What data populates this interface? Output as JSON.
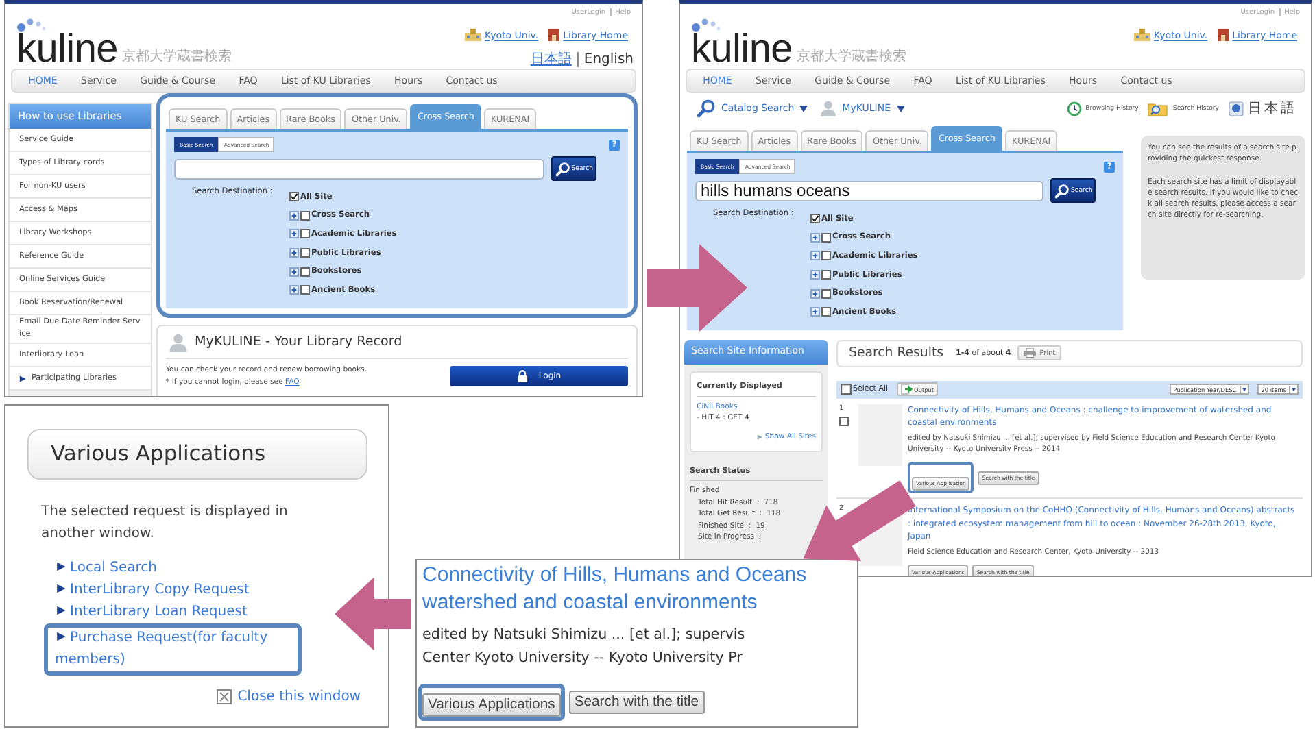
{
  "home_page": {
    "top_links": [
      "UserLogin",
      "Help"
    ],
    "logo": {
      "wordmark": "kuline",
      "subtitle": "京都大学蔵書検索"
    },
    "header_links": [
      {
        "label": "Kyoto Univ.",
        "kind": "university"
      },
      {
        "label": "Library Home",
        "kind": "library"
      }
    ],
    "languages": [
      {
        "label": "日本語",
        "selected": false
      },
      {
        "label": "English",
        "selected": true
      }
    ],
    "nav": [
      {
        "label": "HOME",
        "selected": true
      },
      {
        "label": "Service",
        "selected": false
      },
      {
        "label": "Guide & Course",
        "selected": false
      },
      {
        "label": "FAQ",
        "selected": false
      },
      {
        "label": "List of KU Libraries",
        "selected": false
      },
      {
        "label": "Hours",
        "selected": false
      },
      {
        "label": "Contact us",
        "selected": false
      }
    ],
    "sidebar": {
      "title": "How to use Libraries",
      "items": [
        {
          "label": "Service Guide",
          "kind": "page"
        },
        {
          "label": "Types of Library cards",
          "kind": "page"
        },
        {
          "label": "For non-KU users",
          "kind": "page"
        },
        {
          "label": "Access & Maps",
          "kind": "page"
        },
        {
          "label": "Library Workshops",
          "kind": "page"
        },
        {
          "label": "Reference Guide",
          "kind": "page"
        },
        {
          "label": "Online Services Guide",
          "kind": "page"
        },
        {
          "label": "Book Reservation/Renewal",
          "kind": "page"
        },
        {
          "label": "Email Due Date Reminder Service",
          "kind": "page"
        },
        {
          "label": "Interlibrary Loan",
          "kind": "page"
        },
        {
          "label": "Participating Libraries",
          "kind": "expander"
        }
      ]
    },
    "search": {
      "highlighted": true,
      "tabs": [
        {
          "label": "KU Search",
          "selected": false
        },
        {
          "label": "Articles",
          "selected": false
        },
        {
          "label": "Rare Books",
          "selected": false
        },
        {
          "label": "Other Univ.",
          "selected": false
        },
        {
          "label": "Cross Search",
          "selected": true
        },
        {
          "label": "KURENAI",
          "selected": false
        }
      ],
      "modes": [
        {
          "label": "Basic Search",
          "selected": true
        },
        {
          "label": "Advanced Search",
          "selected": false
        }
      ],
      "help": "?",
      "button": "Search",
      "destination_label": "Search Destination :",
      "destinations": [
        {
          "label": "All Site",
          "checked": true,
          "expandable": false
        },
        {
          "label": "Cross Search",
          "checked": false,
          "expandable": true
        },
        {
          "label": "Academic Libraries",
          "checked": false,
          "expandable": true
        },
        {
          "label": "Public Libraries",
          "checked": false,
          "expandable": true
        },
        {
          "label": "Bookstores",
          "checked": false,
          "expandable": true
        },
        {
          "label": "Ancient Books",
          "checked": false,
          "expandable": true
        }
      ]
    },
    "mykuline": {
      "title": "MyKULINE - Your Library Record",
      "text": "You can check your record and renew borrowing books.",
      "note": "* If you cannot login, please see",
      "link": "FAQ",
      "button": "Login"
    }
  },
  "results_page": {
    "top_links": [
      "UserLogin",
      "Help"
    ],
    "logo": {
      "wordmark": "kuline",
      "subtitle": "京都大学蔵書検索"
    },
    "header_links": [
      {
        "label": "Kyoto Univ.",
        "kind": "university"
      },
      {
        "label": "Library Home",
        "kind": "library"
      }
    ],
    "nav": [
      {
        "label": "HOME",
        "selected": true
      },
      {
        "label": "Service",
        "selected": false
      },
      {
        "label": "Guide & Course",
        "selected": false
      },
      {
        "label": "FAQ",
        "selected": false
      },
      {
        "label": "List of KU Libraries",
        "selected": false
      },
      {
        "label": "Hours",
        "selected": false
      },
      {
        "label": "Contact us",
        "selected": false
      }
    ],
    "menus": [
      {
        "label": "Catalog Search",
        "kind": "search"
      },
      {
        "label": "MyKULINE",
        "kind": "account"
      }
    ],
    "history_links": [
      {
        "label": "Browsing History",
        "kind": "browsing"
      },
      {
        "label": "Search History",
        "kind": "search"
      }
    ],
    "language": "日本語",
    "search": {
      "highlighted": false,
      "tabs": [
        {
          "label": "KU Search",
          "selected": false
        },
        {
          "label": "Articles",
          "selected": false
        },
        {
          "label": "Rare Books",
          "selected": false
        },
        {
          "label": "Other Univ.",
          "selected": false
        },
        {
          "label": "Cross Search",
          "selected": true
        },
        {
          "label": "KURENAI",
          "selected": false
        }
      ],
      "modes": [
        {
          "label": "Basic Search",
          "selected": true
        },
        {
          "label": "Advanced Search",
          "selected": false
        }
      ],
      "help": "?",
      "query": "hills humans oceans",
      "button": "Search",
      "destination_label": "Search Destination :",
      "destinations": [
        {
          "label": "All Site",
          "checked": true,
          "expandable": false
        },
        {
          "label": "Cross Search",
          "checked": false,
          "expandable": true
        },
        {
          "label": "Academic Libraries",
          "checked": false,
          "expandable": true
        },
        {
          "label": "Public Libraries",
          "checked": false,
          "expandable": true
        },
        {
          "label": "Bookstores",
          "checked": false,
          "expandable": true
        },
        {
          "label": "Ancient Books",
          "checked": false,
          "expandable": true
        }
      ]
    },
    "info_note": [
      "You can see the results of a search site providing the quickest response.",
      "Each search site has a limit of displayable search results. If you would like to check all search results, please access a search site directly for re-searching."
    ],
    "site_info": {
      "title": "Search Site Information",
      "displayed_heading": "Currently Displayed",
      "site": "CiNii Books",
      "hits": "- HIT 4 : GET 4",
      "show_all": "Show All Sites",
      "status_heading": "Search Status",
      "status": "Finished",
      "stats": [
        "Total Hit Result  :  718",
        "Total Get Result  :  118",
        "Finished Site  :  19",
        "Site in Progress  :"
      ]
    },
    "results": {
      "title": "Search Results",
      "range": "**1-4** of about **4**",
      "print": "Print",
      "select_all": {
        "label": "Select All",
        "checked": false
      },
      "output": "Output",
      "sort": "Publication Year/DESC",
      "per_page": "20 items",
      "items": [
        {
          "number": "1",
          "checked": false,
          "title": "Connectivity of Hills, Humans and Oceans : challenge to improvement of watershed and coastal environments",
          "authors": "edited by Natsuki Shimizu ... [et al.]; supervised by Field Science Education and Research Center Kyoto University -- Kyoto University Press -- 2014",
          "actions": [
            {
              "label": "Various Application",
              "highlighted": true
            },
            {
              "label": "Search with the title",
              "highlighted": false
            }
          ]
        },
        {
          "number": "2",
          "title": "International Symposium on the CoHHO (Connectivity of Hills, Humans and Oceans) abstracts : integrated ecosystem management from hill to ocean : November 26-28th 2013, Kyoto, Japan",
          "authors": "Field Science Education and Research Center, Kyoto University -- 2013",
          "actions": [
            {
              "label": "Various Applications",
              "highlighted": false
            },
            {
              "label": "Search with the title",
              "highlighted": false
            }
          ]
        }
      ]
    }
  },
  "applications_window": {
    "title": "Various Applications",
    "message": "The selected request is displayed in another window.",
    "links": [
      {
        "label": "Local Search",
        "highlighted": false
      },
      {
        "label": "InterLibrary Copy Request",
        "highlighted": false
      },
      {
        "label": "InterLibrary Loan Request",
        "highlighted": false
      },
      {
        "label": "Purchase Request(for faculty members)",
        "highlighted": true
      }
    ],
    "close": "Close this window"
  },
  "result_detail": {
    "title_lines": [
      "Connectivity of Hills, Humans and Oceans",
      "watershed and coastal environments"
    ],
    "author_lines": [
      "edited by Natsuki Shimizu ... [et al.]; supervis",
      "Center Kyoto University -- Kyoto University Pr"
    ],
    "buttons": [
      {
        "label": "Various Applications",
        "highlighted": true
      },
      {
        "label": "Search with the title",
        "highlighted": false
      }
    ]
  }
}
